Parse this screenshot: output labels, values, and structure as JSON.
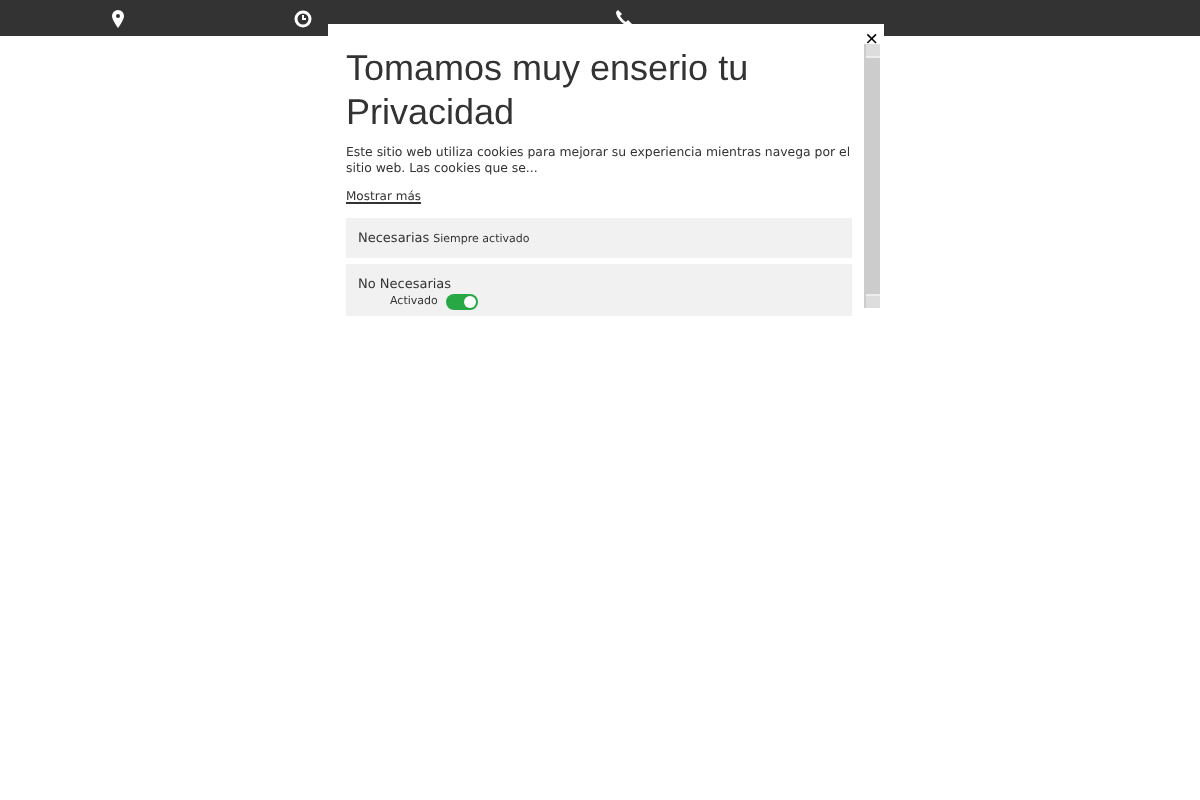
{
  "modal": {
    "title": "Tomamos muy enserio tu Privacidad",
    "description": "Este sitio web utiliza cookies para mejorar su experiencia mientras navega por el sitio web. Las cookies que se...",
    "show_more": "Mostrar más",
    "close": "×",
    "categories": [
      {
        "kind": "always",
        "name": "Necesarias",
        "status": "Siempre activado"
      },
      {
        "kind": "toggle",
        "name": "No Necesarias",
        "status": "Activado",
        "on": true
      }
    ]
  }
}
